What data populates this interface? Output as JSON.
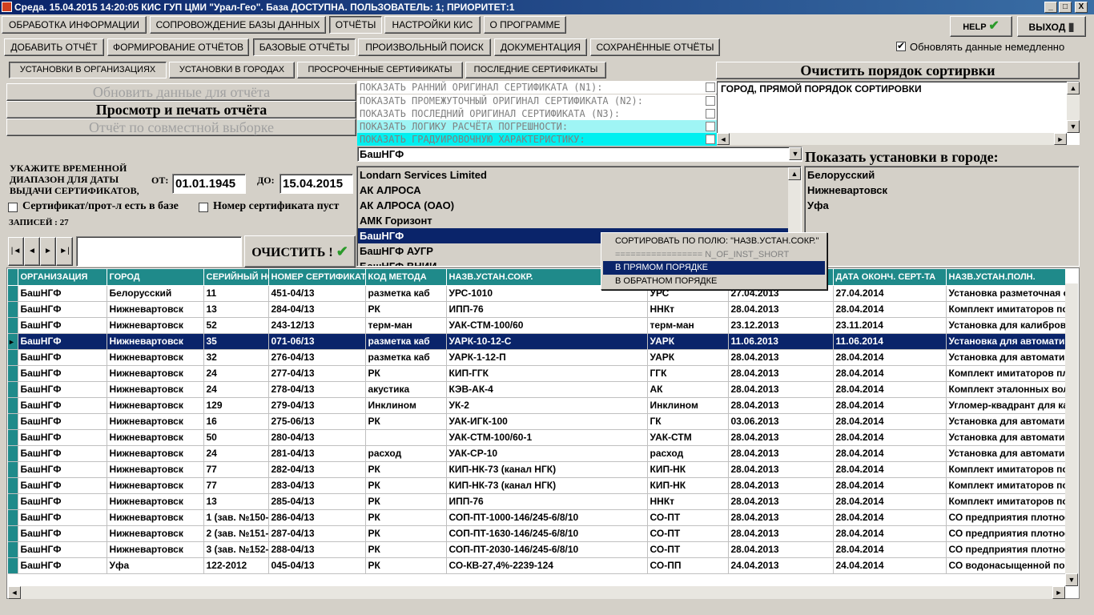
{
  "window": {
    "title": "Среда. 15.04.2015 14:20:05 КИС ГУП ЦМИ \"Урал-Гео\". База ДОСТУПНА. ПОЛЬЗОВАТЕЛЬ: 1; ПРИОРИТЕТ:1",
    "min": "_",
    "max": "□",
    "close": "X"
  },
  "menu": [
    "ОБРАБОТКА ИНФОРМАЦИИ",
    "СОПРОВОЖДЕНИЕ БАЗЫ ДАННЫХ",
    "ОТЧЁТЫ",
    "НАСТРОЙКИ КИС",
    "О ПРОГРАММЕ"
  ],
  "help_label": "HELP",
  "exit_label": "ВЫХОД",
  "subtabs": [
    "ДОБАВИТЬ ОТЧЁТ",
    "ФОРМИРОВАНИЕ ОТЧЁТОВ",
    "БАЗОВЫЕ ОТЧЁТЫ",
    "ПРОИЗВОЛЬНЫЙ ПОИСК",
    "ДОКУМЕНТАЦИЯ",
    "СОХРАНЁННЫЕ ОТЧЁТЫ"
  ],
  "update_now_label": "Обновлять данные немедленно",
  "reports": [
    "УСТАНОВКИ В ОРГАНИЗАЦИЯХ",
    "УСТАНОВКИ В ГОРОДАХ",
    "ПРОСРОЧЕННЫЕ СЕРТИФИКАТЫ",
    "ПОСЛЕДНИЕ СЕРТИФИКАТЫ"
  ],
  "clear_sort_label": "Очистить порядок сортирвки",
  "sort_text": "ГОРОД, ПРЯМОЙ ПОРЯДОК СОРТИРОВКИ",
  "actions": {
    "refresh": "Обновить данные для отчёта",
    "print": "Просмотр и печать отчёта",
    "joint": "Отчёт по совместной выборке"
  },
  "options": [
    "ПОКАЗАТЬ РАННИЙ ОРИГИНАЛ СЕРТИФИКАТА (N1):",
    "ПОКАЗАТЬ ПРОМЕЖУТОЧНЫЙ ОРИГИНАЛ СЕРТИФИКАТА (N2):",
    "ПОКАЗАТЬ ПОСЛЕДНИЙ ОРИГИНАЛ СЕРТИФИКАТА (N3):",
    "ПОКАЗАТЬ ЛОГИКУ РАСЧЁТА ПОГРЕШНОСТИ:",
    "ПОКАЗАТЬ ГРАДУИРОВОЧНУЮ ХАРАКТЕРИСТИКУ:"
  ],
  "org_select": "БашНГФ",
  "org_list": [
    "Londarn Services Limited",
    "АК АЛРОСА",
    "АК АЛРОСА (ОАО)",
    "АМК Горизонт",
    "БашНГФ",
    "БашНГФ АУГР",
    "БашНГФ ВНИИ"
  ],
  "city_title": "Показать установки в городе:",
  "cities": [
    "Белорусский",
    "Нижневартовск",
    "Уфа"
  ],
  "date_range": {
    "label": "УКАЖИТЕ ВРЕМЕННОЙ ДИАПАЗОН ДЛЯ ДАТЫ ВЫДАЧИ СЕРТИФИКАТОВ,",
    "from_label": "ОТ:",
    "from": "01.01.1945",
    "to_label": "ДО:",
    "to": "15.04.2015"
  },
  "filters": {
    "cert": "Сертификат/прот-л есть в базе",
    "empty_num": "Номер сертификата пуст"
  },
  "records_label": "ЗАПИСЕЙ : 27",
  "nav": {
    "first": "|◄",
    "prev": "◄",
    "next": "►",
    "last": "►|",
    "search_value": ""
  },
  "clear_label": "ОЧИСТИТЬ !",
  "context_menu": {
    "title": "СОРТИРОВАТЬ ПО ПОЛЮ: \"НАЗВ.УСТАН.СОКР.\"",
    "sep": "================= N_OF_INST_SHORT",
    "asc": "В ПРЯМОМ ПОРЯДКЕ",
    "desc": "В ОБРАТНОМ ПОРЯДКЕ"
  },
  "table": {
    "columns": [
      "ОРГАНИЗАЦИЯ",
      "ГОРОД",
      "СЕРИЙНЫЙ НОМЕР",
      "НОМЕР СЕРТИФИКАТА",
      "КОД МЕТОДА",
      "НАЗВ.УСТАН.СОКР.",
      "",
      "",
      "ДАТА ОКОНЧ. СЕРТ-ТА",
      "НАЗВ.УСТАН.ПОЛН."
    ],
    "selected_row": 3,
    "rows": [
      [
        "БашНГФ",
        "Белорусский",
        "11",
        "451-04/13",
        "разметка каб",
        "УРС-1010",
        "УРС",
        "27.04.2013",
        "27.04.2014",
        "Установка разметочная с"
      ],
      [
        "БашНГФ",
        "Нижневартовск",
        "13",
        "284-04/13",
        "РК",
        "ИПП-76",
        "ННКт",
        "28.04.2013",
        "28.04.2014",
        "Комплект имитаторов пор"
      ],
      [
        "БашНГФ",
        "Нижневартовск",
        "52",
        "243-12/13",
        "терм-ман",
        "УАК-СТМ-100/60",
        "терм-ман",
        "23.12.2013",
        "23.11.2014",
        "Установка для калибров"
      ],
      [
        "БашНГФ",
        "Нижневартовск",
        "35",
        "071-06/13",
        "разметка каб",
        "УАРК-10-12-С",
        "УАРК",
        "11.06.2013",
        "11.06.2014",
        "Установка для автоматиз"
      ],
      [
        "БашНГФ",
        "Нижневартовск",
        "32",
        "276-04/13",
        "разметка каб",
        "УАРК-1-12-П",
        "УАРК",
        "28.04.2013",
        "28.04.2014",
        "Установка для автоматиз"
      ],
      [
        "БашНГФ",
        "Нижневартовск",
        "24",
        "277-04/13",
        "РК",
        "КИП-ГГК",
        "ГГК",
        "28.04.2013",
        "28.04.2014",
        "Комплект имитаторов пло"
      ],
      [
        "БашНГФ",
        "Нижневартовск",
        "24",
        "278-04/13",
        "акустика",
        "КЭВ-АК-4",
        "АК",
        "28.04.2013",
        "28.04.2014",
        "Комплект эталонных вол"
      ],
      [
        "БашНГФ",
        "Нижневартовск",
        "129",
        "279-04/13",
        "Инклином",
        "УК-2",
        "Инклином",
        "28.04.2013",
        "28.04.2014",
        "Угломер-квадрант для ка"
      ],
      [
        "БашНГФ",
        "Нижневартовск",
        "16",
        "275-06/13",
        "РК",
        "УАК-ИГК-100",
        "ГК",
        "03.06.2013",
        "28.04.2014",
        "Установка для автоматиз"
      ],
      [
        "БашНГФ",
        "Нижневартовск",
        "50",
        "280-04/13",
        "",
        "УАК-СТМ-100/60-1",
        "УАК-СТМ",
        "28.04.2013",
        "28.04.2014",
        "Установка для автоматиз"
      ],
      [
        "БашНГФ",
        "Нижневартовск",
        "24",
        "281-04/13",
        "расход",
        "УАК-СР-10",
        "расход",
        "28.04.2013",
        "28.04.2014",
        "Установка для автоматиз"
      ],
      [
        "БашНГФ",
        "Нижневартовск",
        "77",
        "282-04/13",
        "РК",
        "КИП-НК-73 (канал НГК)",
        "КИП-НК",
        "28.04.2013",
        "28.04.2014",
        "Комплект имитаторов пор"
      ],
      [
        "БашНГФ",
        "Нижневартовск",
        "77",
        "283-04/13",
        "РК",
        "КИП-НК-73 (канал НГК)",
        "КИП-НК",
        "28.04.2013",
        "28.04.2014",
        "Комплект имитаторов пор"
      ],
      [
        "БашНГФ",
        "Нижневартовск",
        "13",
        "285-04/13",
        "РК",
        "ИПП-76",
        "ННКт",
        "28.04.2013",
        "28.04.2014",
        "Комплект имитаторов пор"
      ],
      [
        "БашНГФ",
        "Нижневартовск",
        "1 (зав. №150-",
        "286-04/13",
        "РК",
        "СОП-ПТ-1000-146/245-6/8/10",
        "СО-ПТ",
        "28.04.2013",
        "28.04.2014",
        "СО предприятия плотнос"
      ],
      [
        "БашНГФ",
        "Нижневартовск",
        "2 (зав. №151-",
        "287-04/13",
        "РК",
        "СОП-ПТ-1630-146/245-6/8/10",
        "СО-ПТ",
        "28.04.2013",
        "28.04.2014",
        "СО предприятия плотнос"
      ],
      [
        "БашНГФ",
        "Нижневартовск",
        "3 (зав. №152-",
        "288-04/13",
        "РК",
        "СОП-ПТ-2030-146/245-6/8/10",
        "СО-ПТ",
        "28.04.2013",
        "28.04.2014",
        "СО предприятия плотнос"
      ],
      [
        "БашНГФ",
        "Уфа",
        "122-2012",
        "045-04/13",
        "РК",
        "СО-КВ-27,4%-2239-124",
        "СО-ПП",
        "24.04.2013",
        "24.04.2014",
        "СО водонасыщенной пор"
      ]
    ]
  }
}
